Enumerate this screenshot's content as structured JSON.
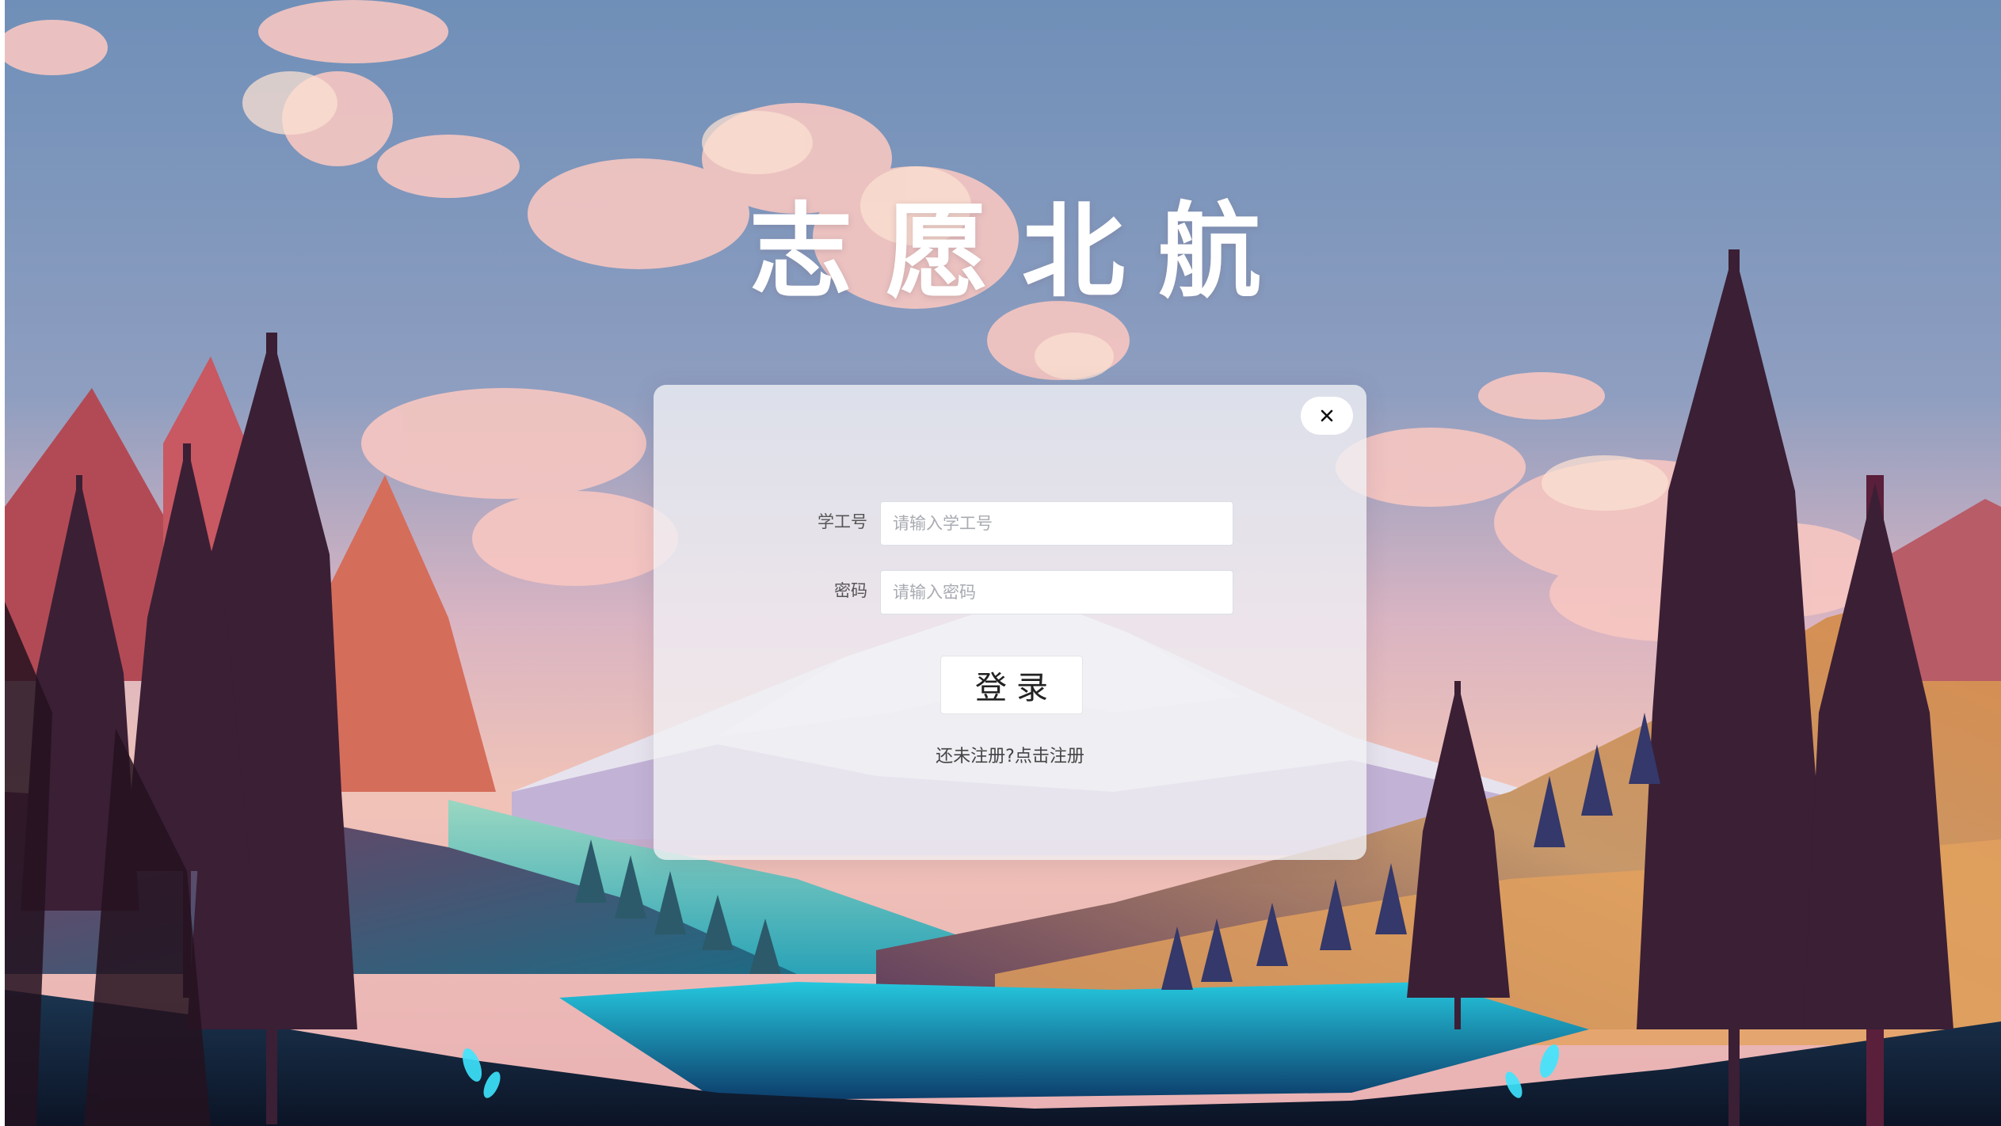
{
  "page": {
    "title": "志愿北航"
  },
  "login_form": {
    "close_icon": "close-icon",
    "student_id": {
      "label": "学工号",
      "value": "",
      "placeholder": "请输入学工号"
    },
    "password": {
      "label": "密码",
      "value": "",
      "placeholder": "请输入密码"
    },
    "login_button_label": "登录",
    "register_prompt": "还未注册?",
    "register_link_label": "点击注册"
  },
  "colors": {
    "sky_top": "#6f8fb8",
    "sky_pink": "#f3b0b5",
    "mountain_snow": "#f4f2f6",
    "forest_dark": "#3a2233",
    "lake": "#1fd1e6",
    "panel": "#f0f0f4",
    "title_text": "#ffffff"
  }
}
